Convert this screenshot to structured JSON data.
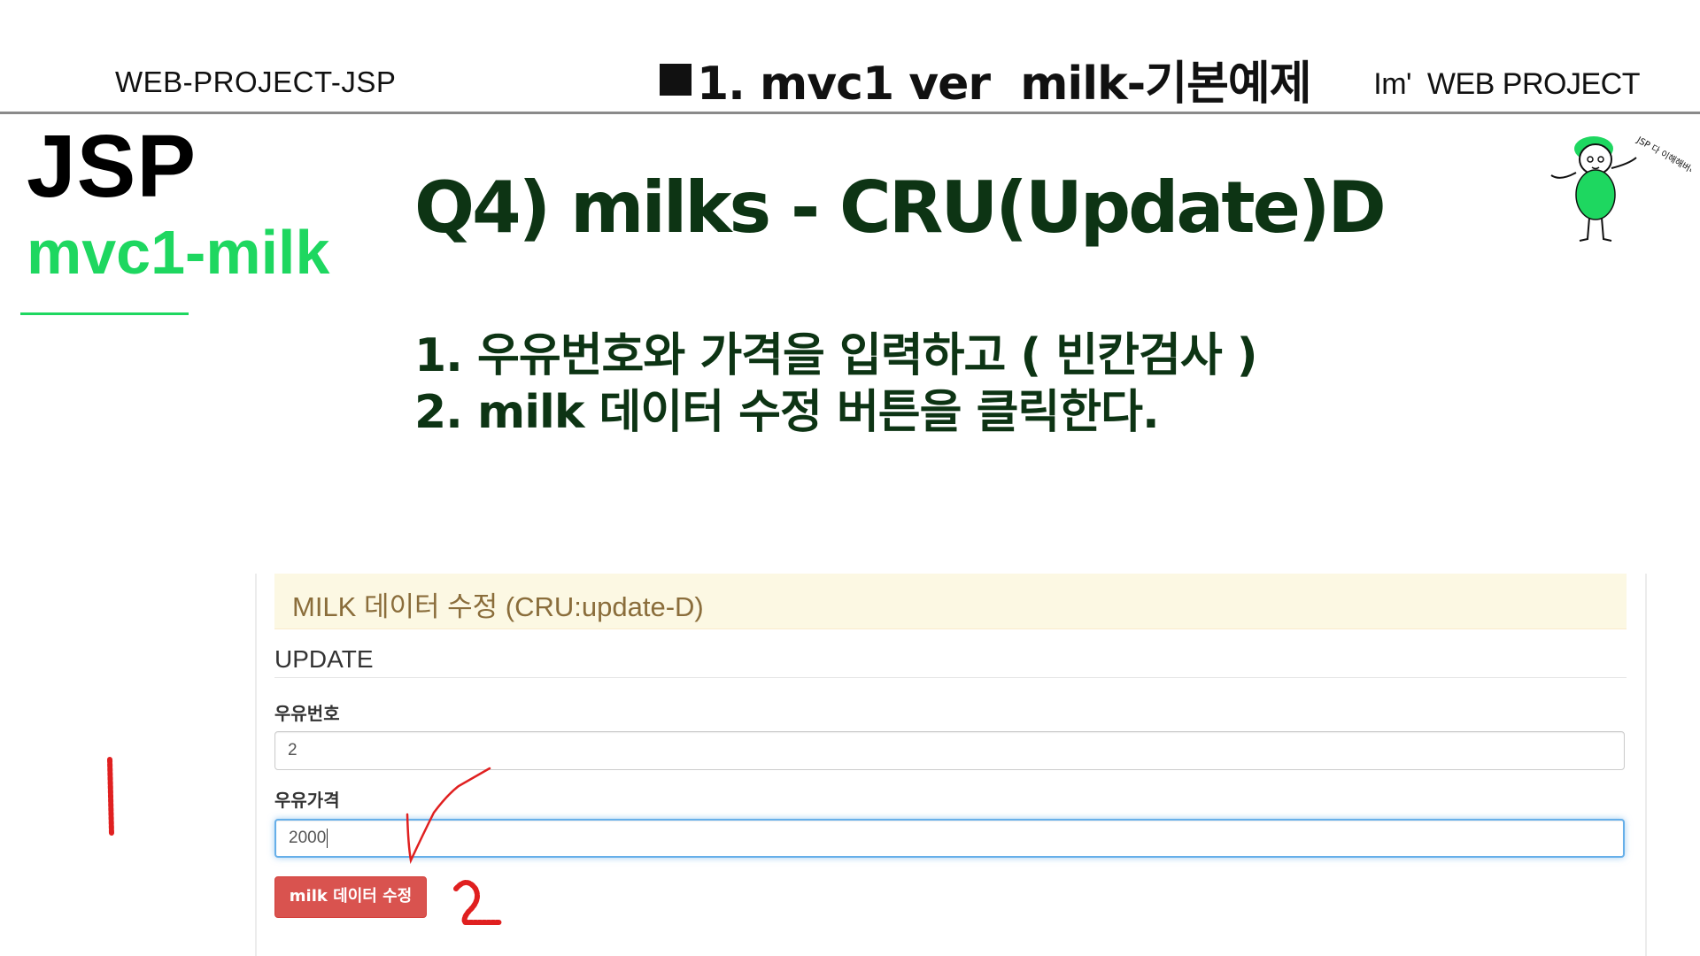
{
  "header": {
    "left": "WEB-PROJECT-JSP",
    "center": "1. mvc1 ver  milk-기본예제",
    "right": "Im'  WEB PROJECT"
  },
  "sidebar": {
    "title": "JSP",
    "subtitle": "mvc1-milk"
  },
  "main": {
    "title": "Q4) milks - CRU(Update)D",
    "steps": [
      "1. 우유번호와 가격을 입력하고 ( 빈칸검사 )",
      "2. milk 데이터 수정 버튼을 클릭한다."
    ]
  },
  "mascot": {
    "icon": "character-mascot-icon",
    "caption": "JSP 다 이해해버리겠다~!"
  },
  "form": {
    "panel_title": "MILK 데이터 수정 (CRU:update-D)",
    "legend": "UPDATE",
    "milk_no_label": "우유번호",
    "milk_no_value": "2",
    "price_label": "우유가격",
    "price_value": "2000",
    "submit_label": "milk 데이터 수정"
  },
  "annotations": {
    "mark_1": "1",
    "mark_2": "2"
  },
  "colors": {
    "accent_green": "#1ed760",
    "title_dark_green": "#0d3414",
    "panel_heading_bg": "#fcf8e3",
    "danger_button": "#d9534f",
    "annotation_red": "#e02020"
  }
}
